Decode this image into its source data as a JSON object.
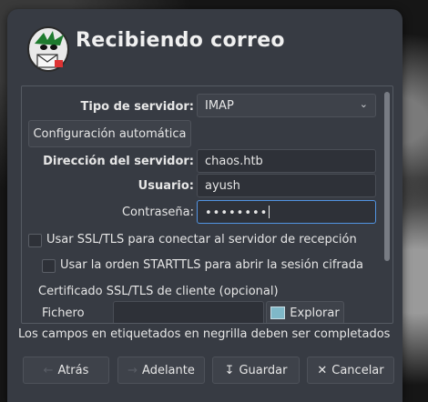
{
  "dialog": {
    "title": "Recibiendo correo"
  },
  "form": {
    "server_type": {
      "label": "Tipo de servidor:",
      "value": "IMAP"
    },
    "autoconfig_label": "Configuración automática",
    "server_address": {
      "label": "Dirección del servidor:",
      "value": "chaos.htb"
    },
    "user": {
      "label": "Usuario:",
      "value": "ayush"
    },
    "password": {
      "label": "Contraseña:",
      "value": "••••••••"
    },
    "ssl_label": "Usar SSL/TLS para conectar al servidor de recepción",
    "starttls_label": "Usar la orden STARTTLS para abrir la sesión cifrada",
    "client_cert_label": "Certificado SSL/TLS de cliente (opcional)",
    "file_label": "Fichero",
    "browse_label": "Explorar"
  },
  "note": "Los campos en etiquetados en negrilla deben ser completados",
  "buttons": {
    "back": "Atrás",
    "forward": "Adelante",
    "save": "Guardar",
    "cancel": "Cancelar"
  }
}
